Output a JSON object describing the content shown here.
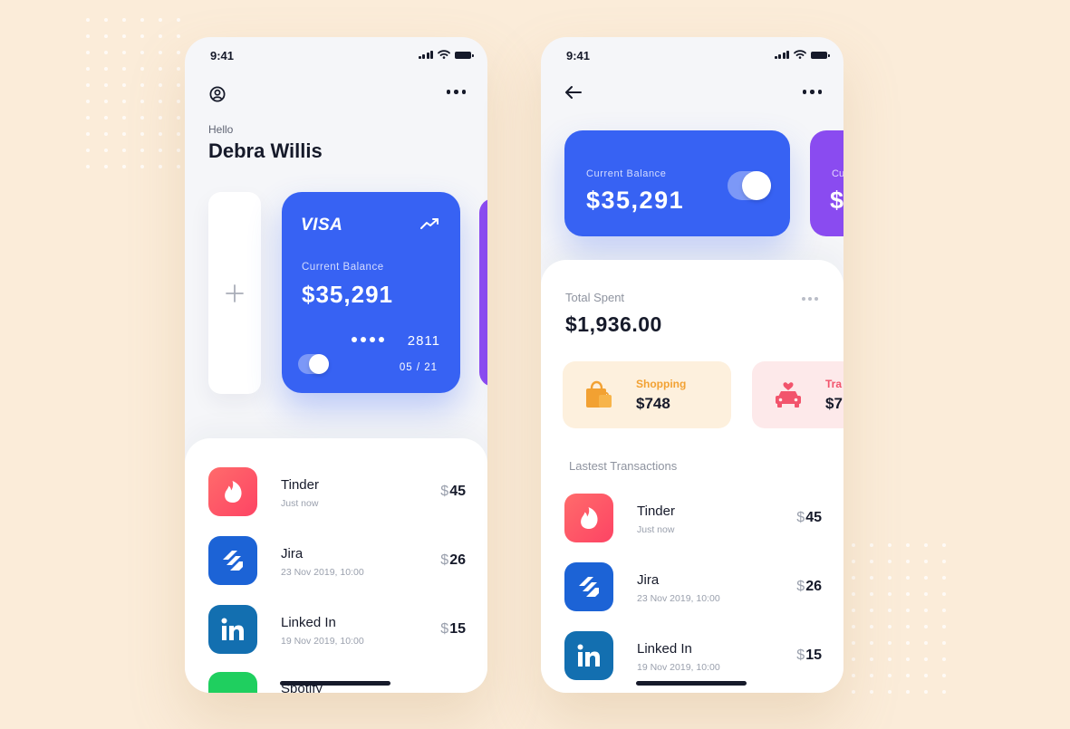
{
  "theme": {
    "background": "#fbecd9",
    "accent": "#3762f3",
    "secondary_card": "#8a4bf0"
  },
  "phone_left": {
    "status_time": "9:41",
    "greeting": "Hello",
    "user_name": "Debra Willis",
    "card": {
      "brand": "VISA",
      "label": "Current Balance",
      "balance": "$35,291",
      "last4": "2811",
      "expiry": "05 / 21",
      "toggle_on": true
    },
    "transactions": [
      {
        "name": "Tinder",
        "time": "Just now",
        "currency": "$",
        "amount": "45",
        "icon": "tinder-icon"
      },
      {
        "name": "Jira",
        "time": "23 Nov 2019, 10:00",
        "currency": "$",
        "amount": "26",
        "icon": "jira-icon"
      },
      {
        "name": "Linked In",
        "time": "19 Nov 2019, 10:00",
        "currency": "$",
        "amount": "15",
        "icon": "linkedin-icon"
      },
      {
        "name": "Spotify",
        "icon": "spotify-icon"
      }
    ]
  },
  "phone_right": {
    "status_time": "9:41",
    "balance_card": {
      "label": "Current Balance",
      "balance": "$35,291",
      "toggle_on": true
    },
    "peek_card": {
      "label": "Cu",
      "value": "$"
    },
    "total_spent": {
      "label": "Total Spent",
      "value": "$1,936.00"
    },
    "categories": [
      {
        "label": "Shopping",
        "value": "$748",
        "icon": "shopping-bag-icon"
      },
      {
        "label": "Tra",
        "value": "$7",
        "icon": "car-heart-icon"
      }
    ],
    "latest_label": "Lastest Transactions",
    "transactions": [
      {
        "name": "Tinder",
        "time": "Just now",
        "currency": "$",
        "amount": "45",
        "icon": "tinder-icon"
      },
      {
        "name": "Jira",
        "time": "23 Nov 2019, 10:00",
        "currency": "$",
        "amount": "26",
        "icon": "jira-icon"
      },
      {
        "name": "Linked In",
        "time": "19 Nov 2019, 10:00",
        "currency": "$",
        "amount": "15",
        "icon": "linkedin-icon"
      }
    ]
  }
}
